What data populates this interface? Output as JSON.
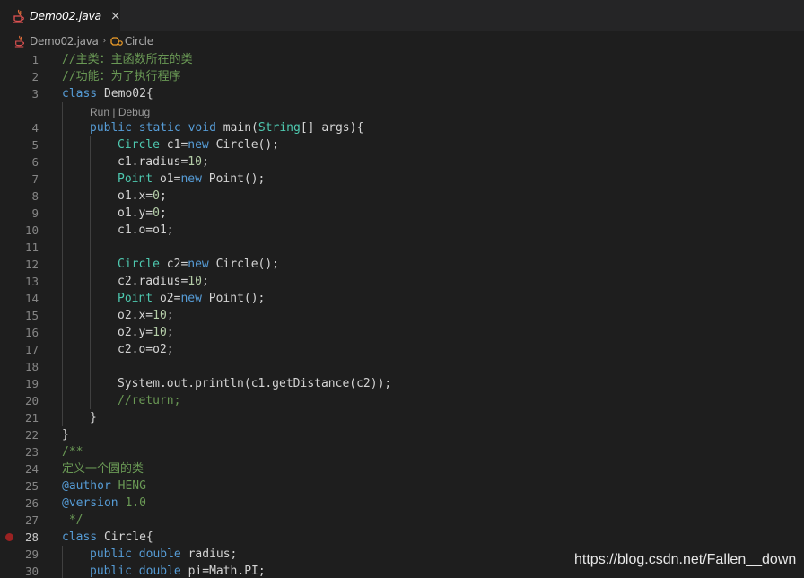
{
  "tab": {
    "label": "Demo02.java",
    "close": "×"
  },
  "breadcrumbs": {
    "file": "Demo02.java",
    "separator": "›",
    "symbol": "Circle"
  },
  "codelens": {
    "run": "Run",
    "sep": " | ",
    "debug": "Debug"
  },
  "colors": {
    "keyword": "#569cd6",
    "type": "#4ec9b0",
    "comment": "#6a9955",
    "number": "#b5cea8",
    "text": "#d4d4d4",
    "breakpoint": "#9a2222",
    "background": "#1e1e1e",
    "tabbar": "#252526"
  },
  "icons": {
    "tab": "java-icon",
    "breadcrumb_file": "java-icon",
    "breadcrumb_symbol": "class-icon",
    "gutter": "breakpoint-icon"
  },
  "lines": [
    {
      "n": "1",
      "indent": 0,
      "tokens": [
        [
          "c",
          "//主类：主函数所在的类"
        ]
      ]
    },
    {
      "n": "2",
      "indent": 0,
      "tokens": [
        [
          "c",
          "//功能：为了执行程序"
        ]
      ]
    },
    {
      "n": "3",
      "indent": 0,
      "tokens": [
        [
          "k",
          "class"
        ],
        [
          "p",
          " Demo02{"
        ]
      ]
    },
    {
      "lens": true
    },
    {
      "n": "4",
      "indent": 1,
      "tokens": [
        [
          "k",
          "public"
        ],
        [
          "p",
          " "
        ],
        [
          "k",
          "static"
        ],
        [
          "p",
          " "
        ],
        [
          "k",
          "void"
        ],
        [
          "p",
          " main("
        ],
        [
          "t",
          "String"
        ],
        [
          "p",
          "[] args){"
        ]
      ]
    },
    {
      "n": "5",
      "indent": 2,
      "tokens": [
        [
          "t",
          "Circle"
        ],
        [
          "p",
          " c1="
        ],
        [
          "k",
          "new"
        ],
        [
          "p",
          " Circle();"
        ]
      ]
    },
    {
      "n": "6",
      "indent": 2,
      "tokens": [
        [
          "p",
          "c1.radius="
        ],
        [
          "n",
          "10"
        ],
        [
          "p",
          ";"
        ]
      ]
    },
    {
      "n": "7",
      "indent": 2,
      "tokens": [
        [
          "t",
          "Point"
        ],
        [
          "p",
          " o1="
        ],
        [
          "k",
          "new"
        ],
        [
          "p",
          " Point();"
        ]
      ]
    },
    {
      "n": "8",
      "indent": 2,
      "tokens": [
        [
          "p",
          "o1.x="
        ],
        [
          "n",
          "0"
        ],
        [
          "p",
          ";"
        ]
      ]
    },
    {
      "n": "9",
      "indent": 2,
      "tokens": [
        [
          "p",
          "o1.y="
        ],
        [
          "n",
          "0"
        ],
        [
          "p",
          ";"
        ]
      ]
    },
    {
      "n": "10",
      "indent": 2,
      "tokens": [
        [
          "p",
          "c1.o=o1;"
        ]
      ]
    },
    {
      "n": "11",
      "indent": 2,
      "tokens": []
    },
    {
      "n": "12",
      "indent": 2,
      "tokens": [
        [
          "t",
          "Circle"
        ],
        [
          "p",
          " c2="
        ],
        [
          "k",
          "new"
        ],
        [
          "p",
          " Circle();"
        ]
      ]
    },
    {
      "n": "13",
      "indent": 2,
      "tokens": [
        [
          "p",
          "c2.radius="
        ],
        [
          "n",
          "10"
        ],
        [
          "p",
          ";"
        ]
      ]
    },
    {
      "n": "14",
      "indent": 2,
      "tokens": [
        [
          "t",
          "Point"
        ],
        [
          "p",
          " o2="
        ],
        [
          "k",
          "new"
        ],
        [
          "p",
          " Point();"
        ]
      ]
    },
    {
      "n": "15",
      "indent": 2,
      "tokens": [
        [
          "p",
          "o2.x="
        ],
        [
          "n",
          "10"
        ],
        [
          "p",
          ";"
        ]
      ]
    },
    {
      "n": "16",
      "indent": 2,
      "tokens": [
        [
          "p",
          "o2.y="
        ],
        [
          "n",
          "10"
        ],
        [
          "p",
          ";"
        ]
      ]
    },
    {
      "n": "17",
      "indent": 2,
      "tokens": [
        [
          "p",
          "c2.o=o2;"
        ]
      ]
    },
    {
      "n": "18",
      "indent": 2,
      "tokens": []
    },
    {
      "n": "19",
      "indent": 2,
      "tokens": [
        [
          "p",
          "System.out.println(c1.getDistance(c2));"
        ]
      ]
    },
    {
      "n": "20",
      "indent": 2,
      "tokens": [
        [
          "c",
          "//return;"
        ]
      ]
    },
    {
      "n": "21",
      "indent": 1,
      "tokens": [
        [
          "p",
          "}"
        ]
      ]
    },
    {
      "n": "22",
      "indent": 0,
      "tokens": [
        [
          "p",
          "}"
        ]
      ]
    },
    {
      "n": "23",
      "indent": 0,
      "tokens": [
        [
          "c",
          "/**"
        ]
      ]
    },
    {
      "n": "24",
      "indent": 0,
      "tokens": [
        [
          "c",
          "定义一个圆的类"
        ]
      ]
    },
    {
      "n": "25",
      "indent": 0,
      "tokens": [
        [
          "k",
          "@author"
        ],
        [
          "c",
          " HENG"
        ]
      ]
    },
    {
      "n": "26",
      "indent": 0,
      "tokens": [
        [
          "k",
          "@version"
        ],
        [
          "c",
          " 1.0"
        ]
      ]
    },
    {
      "n": "27",
      "indent": 0,
      "tokens": [
        [
          "c",
          " */"
        ]
      ]
    },
    {
      "n": "28",
      "indent": 0,
      "breakpoint": true,
      "tokens": [
        [
          "k",
          "class"
        ],
        [
          "p",
          " Circle{"
        ]
      ]
    },
    {
      "n": "29",
      "indent": 1,
      "tokens": [
        [
          "k",
          "public"
        ],
        [
          "p",
          " "
        ],
        [
          "k",
          "double"
        ],
        [
          "p",
          " radius;"
        ]
      ]
    },
    {
      "n": "30",
      "indent": 1,
      "tokens": [
        [
          "k",
          "public"
        ],
        [
          "p",
          " "
        ],
        [
          "k",
          "double"
        ],
        [
          "p",
          " pi=Math.PI;"
        ]
      ]
    }
  ],
  "watermark": "https://blog.csdn.net/Fallen__down"
}
